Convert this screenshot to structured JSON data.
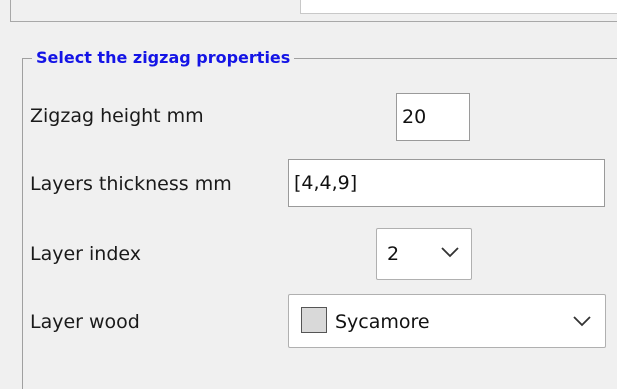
{
  "group": {
    "title": "Select the zigzag properties"
  },
  "zigzag_height": {
    "label": "Zigzag height mm",
    "value": "20"
  },
  "layers_thickness": {
    "label": "Layers thickness mm",
    "value": "[4,4,9]"
  },
  "layer_index": {
    "label": "Layer index",
    "selected": "2"
  },
  "layer_wood": {
    "label": "Layer wood",
    "selected": "Sycamore",
    "swatch_color": "#d9d9d9"
  }
}
